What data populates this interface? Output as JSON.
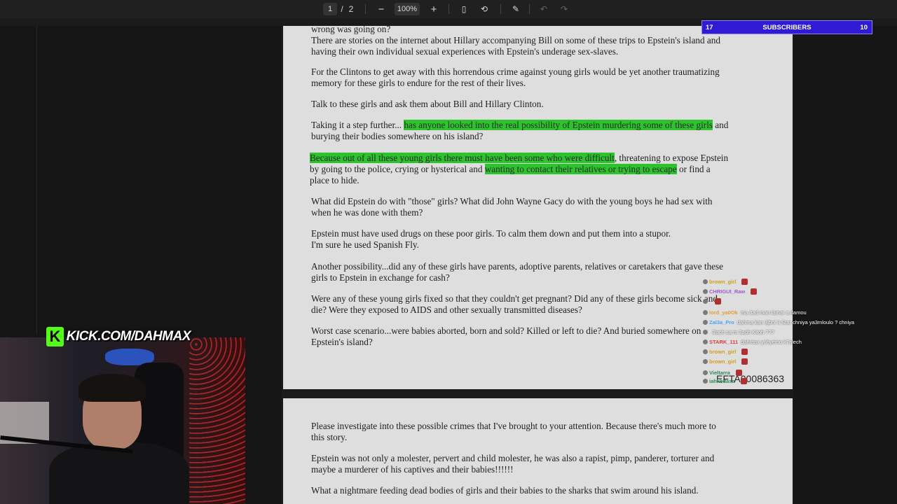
{
  "toolbar": {
    "page_current": "1",
    "page_separator": "/",
    "page_total": "2",
    "zoom_out": "−",
    "zoom": "100%",
    "zoom_in": "+",
    "icons": [
      "fit-page-icon",
      "rotate-icon",
      "draw-icon",
      "undo-icon",
      "redo-icon"
    ],
    "glyphs": {
      "fit": "▯",
      "rotate": "⟲",
      "draw": "✎",
      "undo": "↶",
      "redo": "↷"
    }
  },
  "subscribers": {
    "left": "17",
    "label": "SUBSCRIBERS",
    "right": "10"
  },
  "kick": {
    "k": "K",
    "text": "KICK.COM/DAHMAX"
  },
  "page1": {
    "p0": "wrong was going on?\nThere are stories on the internet about Hillary accompanying Bill on some of these trips to Epstein's island and\nhaving their own individual sexual experiences with Epstein's underage sex-slaves.",
    "p1": "For the Clintons to get away with this horrendous crime against young girls would be yet another traumatizing\nmemory for these girls to endure for the rest of their lives.",
    "p2": "Talk to these girls and ask them about Bill and Hillary Clinton.",
    "p3_a": "Taking it a step further... ",
    "p3_hl": "has anyone looked into the real possibility of Epstein murdering some of these girls",
    "p3_b": " and\nburying their bodies somewhere on his island?",
    "p4_hl1": "Because out of all these young girls there must have been some who were difficult",
    "p4_a": ", threatening to expose Epstein\nby going to the police, crying or hysterical and ",
    "p4_hl2": "wanting to contact their relatives or trying to escape",
    "p4_b": " or find a\nplace to hide.",
    "p5": "What did Epstein do with \"those\" girls? What did John Wayne Gacy do with the young boys he had sex with\nwhen he was done with them?",
    "p6": "Epstein must have used drugs on these poor girls. To calm them down and put them into a stupor.\nI'm sure he used Spanish Fly.",
    "p7": "Another possibility...did any of these girls have parents, adoptive parents, relatives or caretakers that gave these\ngirls to Epstein in exchange for cash?",
    "p8": "Were any of these young girls fixed so that they couldn't get pregnant? Did any of these girls become sick and\ndie? Were they exposed to AIDS and other sexually transmitted diseases?",
    "p9": "Worst case scenario...were babies aborted, born and sold? Killed or left to die? And buried somewhere on\nEpstein's island?",
    "page_id": "EFTA00086363"
  },
  "page2": {
    "p0": "Please investigate into these possible crimes that I've brought to your attention. Because there's much more to\nthis story.",
    "p1": "Epstein was not only a molester, pervert and child molester, he was also a rapist, pimp, panderer, torturer and\nmaybe a murderer of his captives and their babies!!!!!!",
    "p2": "What a nightmare feeding dead bodies of girls and their babies to the sharks that swim around his island."
  },
  "chat": [
    {
      "name": "brown_girl",
      "color": "#d4a017",
      "msg": ""
    },
    {
      "name": "CHRIGUI_Raw",
      "color": "#9b59d0",
      "msg": ""
    },
    {
      "name": "",
      "color": "#2e8b57",
      "msg": ""
    },
    {
      "name": "lord_ya0Ok",
      "color": "#e0a030",
      "msg": "ma 3ad man lamar a damou"
    },
    {
      "name": "Zal3a_Pro",
      "color": "#4aa3ff",
      "msg": "dahma kan 3jbni 3 Star chniya ya3mloulo ? chniya"
    },
    {
      "name": "",
      "color": "#c0c0c0",
      "msg": "3lach sa m 3adh Kitoh ???"
    },
    {
      "name": "STARK_111",
      "color": "#e04040",
      "msg": "dahmax yohyeino k7alech"
    },
    {
      "name": "brown_girl",
      "color": "#d4a017",
      "msg": ""
    },
    {
      "name": "brown_girl",
      "color": "#d4a017",
      "msg": ""
    },
    {
      "name": "Vieltarra",
      "color": "#2e8b57",
      "msg": ""
    },
    {
      "name": "iahkbdasa",
      "color": "#2e8b57",
      "msg": ""
    }
  ],
  "colors": {
    "highlight": "#2fc22f",
    "subscriber_bar": "#2e1bd3",
    "kick_green": "#53fc18"
  }
}
